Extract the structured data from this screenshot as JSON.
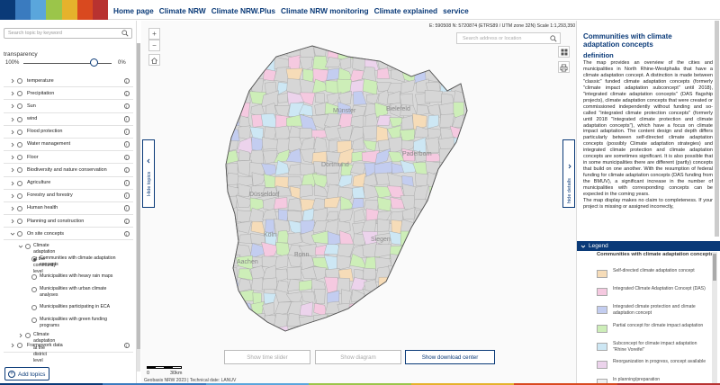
{
  "colors": {
    "brand_navy": "#0a3a78",
    "stripe": [
      "#0a3a78",
      "#3a7bbf",
      "#5aa6dc",
      "#9bc54a",
      "#e5b22c",
      "#d9491f",
      "#b83230"
    ]
  },
  "nav": {
    "items": [
      "Home page",
      "Climate NRW",
      "Climate NRW.Plus",
      "Climate NRW monitoring",
      "Climate explained",
      "service"
    ]
  },
  "left_panel": {
    "search_placeholder": "Search topic by keyword",
    "search_icon": "search-icon",
    "transparency_label": "transparency",
    "transparency_min_label": "100%",
    "transparency_max_label": "0%",
    "transparency_level": 0.8,
    "topics": [
      "temperature",
      "Precipitation",
      "Sun",
      "wind",
      "Flood protection",
      "Water management",
      "Floor",
      "Biodiversity and nature conservation",
      "Agriculture",
      "Forestry and forestry",
      "Human health",
      "Planning and construction"
    ],
    "on_site": {
      "label": "On site concepts",
      "community_level": {
        "label": "Climate adaptation at the community level",
        "items": [
          {
            "label": "Communities with climate adaptation concepts",
            "selected": true
          },
          {
            "label": "Municipalities with heavy rain maps",
            "selected": false
          },
          {
            "label": "Municipalities with urban climate analyses",
            "selected": false
          },
          {
            "label": "Municipalities participating in ECA",
            "selected": false
          },
          {
            "label": "Municipalities with green funding programs",
            "selected": false
          }
        ]
      },
      "district_level": "Climate adaptation at the district level"
    },
    "framework": "Framework data",
    "add_topics": "Add topics",
    "info_glyph": "i"
  },
  "map": {
    "coords": "E: 590508 N: 5720874 (ETRS89 / UTM zone 32N)  Scale 1:1,293,350",
    "address_placeholder": "Search address or location",
    "zoom_in": "+",
    "zoom_out": "−",
    "hide_topics": "Hide topics",
    "hide_details": "hide details",
    "btn_time_slider": "Show time slider",
    "btn_diagram": "Show diagram",
    "btn_download": "Show download center",
    "scale_0": "0",
    "scale_30": "30km",
    "attribution": "Geobasis NRW 2023 | Technical date: LANUV",
    "cities": [
      "Münster",
      "Bielefeld",
      "Dortmund",
      "Düsseldorf",
      "Köln",
      "Bonn",
      "Aachen",
      "Siegen",
      "Paderborn"
    ]
  },
  "details": {
    "title": "Communities with climate adaptation concepts",
    "definition_heading": "definition",
    "definition_text": "The map provides an overview of the cities and municipalities in North Rhine-Westphalia that have a climate adaptation concept. A distinction is made between \"classic\" funded climate adaptation concepts (formerly \"climate impact adaptation subconcept\" until 2018), \"integrated climate adaptation concepts\" (DAS flagship projects), climate adaptation concepts that were created or commissioned independently without funding and so-called \"integrated climate protection concepts\" (formerly until 2018 \"Integrated climate protection and climate adaptation concepts\"), which have a focus on climate impact adaptation. The content design and depth differs particularly between self-directed climate adaptation concepts (possibly Climate adaptation strategies) and integrated climate protection and climate adaptation concepts are sometimes significant. It is also possible that in some municipalities there are different (partly) concepts that build on one another. With the resumption of federal funding for climate adaptation concepts (DAS funding from the BMUV), a significant increase in the number of municipalities with corresponding concepts can be expected in the coming years.\nThe map display makes no claim to completeness. If your project is missing or assigned incorrectly,",
    "legend_label": "Legend",
    "legend_heading": "Communities with climate adaptation concepts",
    "legend_items": [
      {
        "label": "Self-directed climate adaptation concept",
        "color": "#f6dcb8"
      },
      {
        "label": "Integrated Climate Adaptation Concept (DAS)",
        "color": "#f5c9e0"
      },
      {
        "label": "Integrated climate protection and climate adaptation concept",
        "color": "#c3cdf0"
      },
      {
        "label": "Partial concept for climate impact adaptation",
        "color": "#cdeeb8"
      },
      {
        "label": "Subconcept for climate impact adaptation \"Rhine Voreifel\"",
        "color": "#cde7f4"
      },
      {
        "label": "Reorganization in progress, concept available",
        "color": "#ecd3ec"
      },
      {
        "label": "In planning/preparation",
        "color": "#eeeeee"
      }
    ]
  }
}
